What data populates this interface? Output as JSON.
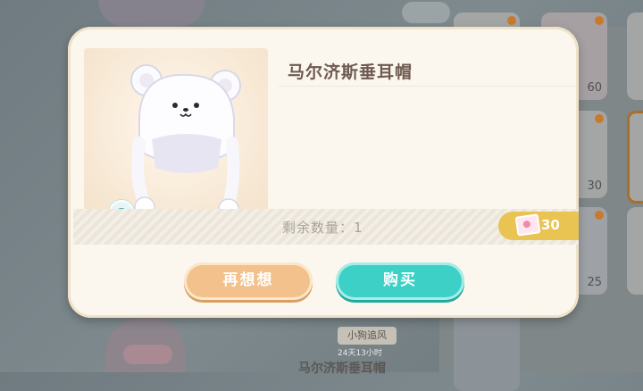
{
  "background": {
    "top_header": "…(部分遮挡)",
    "tag_label": "小狗追风",
    "timer": "24天13小时",
    "item_name": "马尔济斯垂耳帽",
    "card_prices": [
      "60",
      "30",
      "25"
    ]
  },
  "modal": {
    "item_title": "马尔济斯垂耳帽",
    "remaining_label": "剩余数量：1",
    "price": "30",
    "cancel_label": "再想想",
    "buy_label": "购买"
  },
  "icons": {
    "preview": "eye-icon",
    "currency": "ticket-icon"
  },
  "colors": {
    "buy_button": "#3dd0c6",
    "cancel_button": "#f2c18c",
    "price_tag": "#e9c452",
    "modal_bg": "#fbf7ef"
  }
}
